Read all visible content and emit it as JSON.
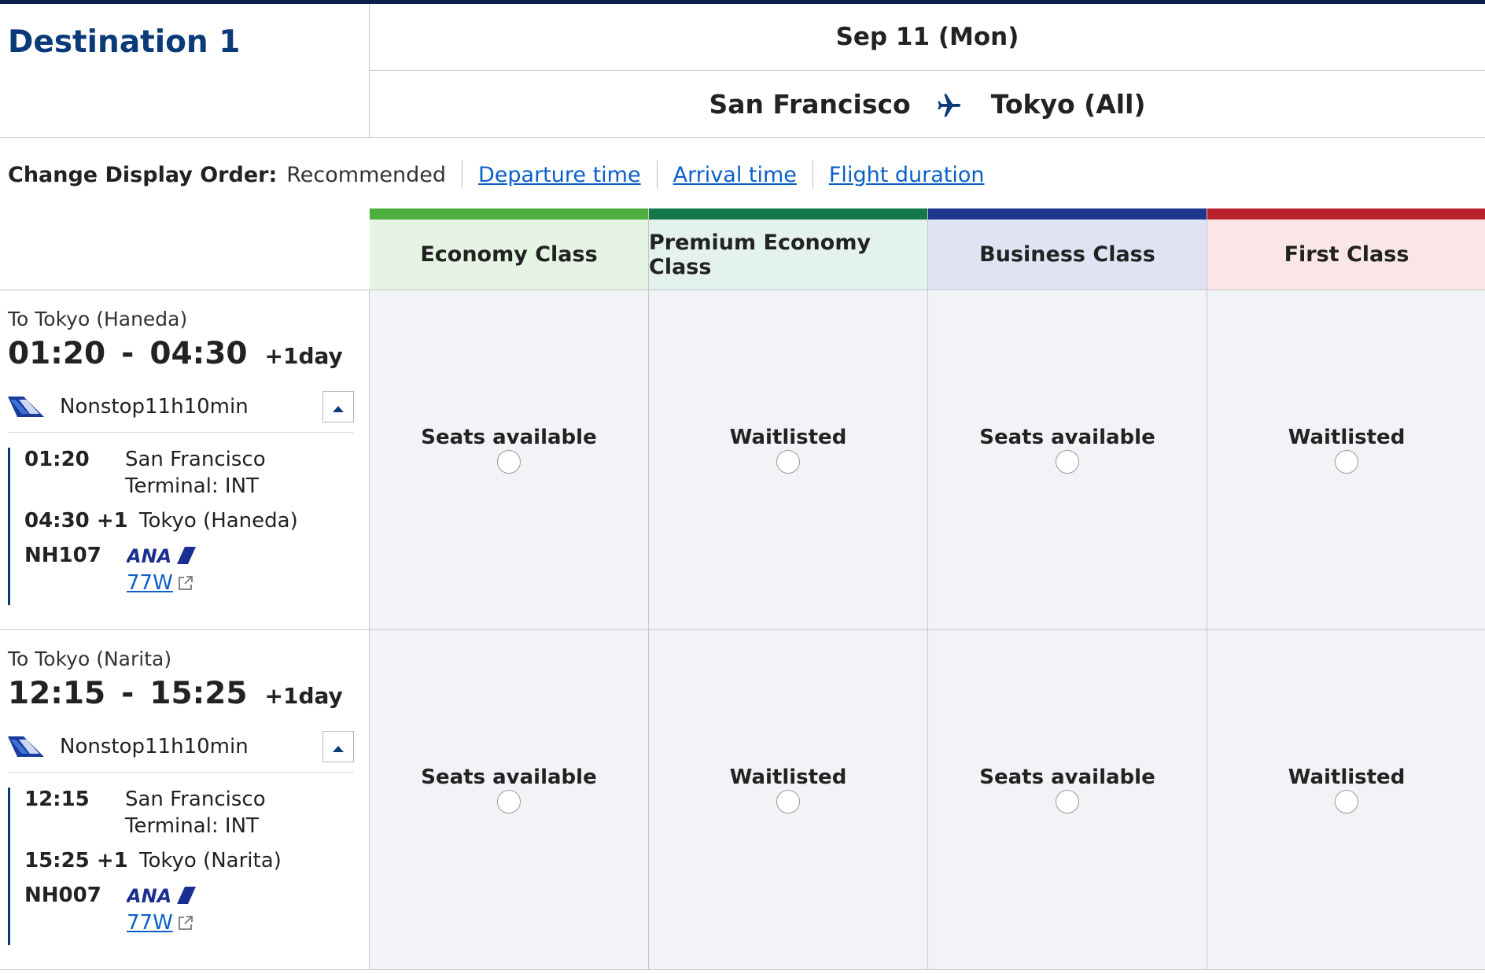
{
  "header": {
    "destination_title": "Destination 1",
    "date": "Sep 11 (Mon)",
    "origin": "San Francisco",
    "destination": "Tokyo (All)"
  },
  "sort": {
    "label": "Change Display Order:",
    "current": "Recommended",
    "options": [
      "Departure time",
      "Arrival time",
      "Flight duration"
    ]
  },
  "classes": [
    {
      "name": "Economy Class",
      "bar_color": "#4caf3e",
      "bg": "#e6f4e3"
    },
    {
      "name": "Premium Economy Class",
      "bar_color": "#14774a",
      "bg": "#e3f3ec"
    },
    {
      "name": "Business Class",
      "bar_color": "#1f3590",
      "bg": "#dfe3f4"
    },
    {
      "name": "First Class",
      "bar_color": "#b8202c",
      "bg": "#fae6e7"
    }
  ],
  "flights": [
    {
      "destination_label": "To Tokyo (Haneda)",
      "depart": "01:20",
      "dash": "-",
      "arrive": "04:30",
      "plus_day": "+1day",
      "nonstop": "Nonstop",
      "duration": "11h10min",
      "seg_depart_time": "01:20",
      "seg_depart_city": "San Francisco",
      "seg_terminal": "Terminal: INT",
      "seg_arrive_time": "04:30 +1",
      "seg_arrive_city": "Tokyo (Haneda)",
      "flight_number": "NH107",
      "aircraft": "77W",
      "availability": [
        "Seats available",
        "Waitlisted",
        "Seats available",
        "Waitlisted"
      ]
    },
    {
      "destination_label": "To Tokyo (Narita)",
      "depart": "12:15",
      "dash": "-",
      "arrive": "15:25",
      "plus_day": "+1day",
      "nonstop": "Nonstop",
      "duration": "11h10min",
      "seg_depart_time": "12:15",
      "seg_depart_city": "San Francisco",
      "seg_terminal": "Terminal: INT",
      "seg_arrive_time": "15:25 +1",
      "seg_arrive_city": "Tokyo (Narita)",
      "flight_number": "NH007",
      "aircraft": "77W",
      "availability": [
        "Seats available",
        "Waitlisted",
        "Seats available",
        "Waitlisted"
      ]
    }
  ],
  "icons": {
    "route": "airplane-icon",
    "collapse": "chevron-up-icon",
    "external": "external-link-icon",
    "airline_tail": "ana-tail-logo",
    "airline_wordmark": "ana-logo"
  },
  "colors": {
    "brand_navy": "#0b3a78",
    "link": "#0a5fc9"
  }
}
